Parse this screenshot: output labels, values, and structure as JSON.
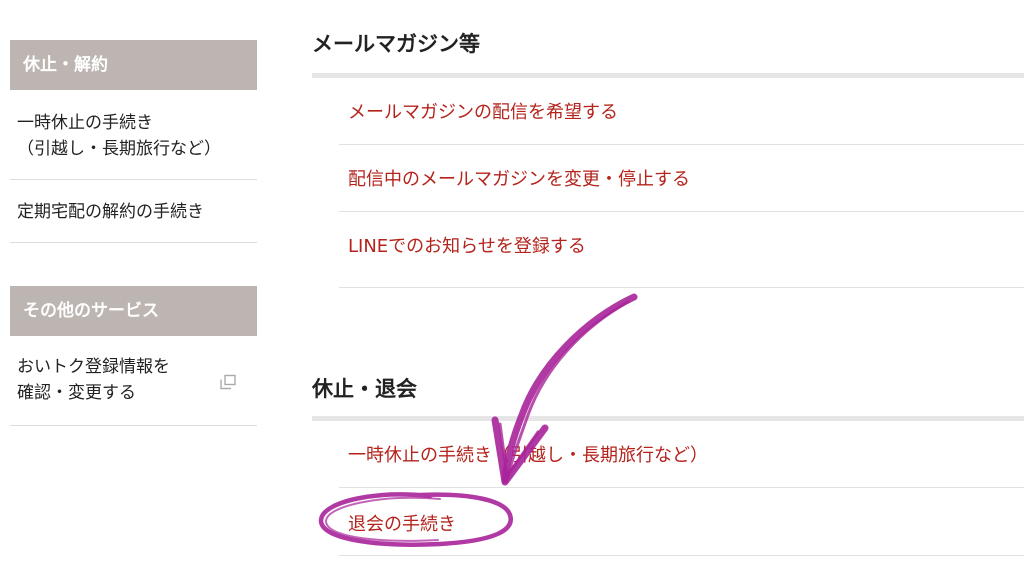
{
  "sidebar": {
    "sections": [
      {
        "title": "休止・解約",
        "items": [
          {
            "lines": [
              "一時休止の手続き",
              "（引越し・長期旅行など）"
            ]
          },
          {
            "lines": [
              "定期宅配の解約の手続き"
            ]
          }
        ]
      },
      {
        "title": "その他のサービス",
        "items": [
          {
            "lines": [
              "おいトク登録情報を",
              "確認・変更する"
            ],
            "icon": "external-window-icon"
          }
        ]
      }
    ]
  },
  "main": {
    "sections": [
      {
        "title": "メールマガジン等",
        "links": [
          "メールマガジンの配信を希望する",
          "配信中のメールマガジンを変更・停止する",
          "LINEでのお知らせを登録する"
        ]
      },
      {
        "title": "休止・退会",
        "links": [
          "一時休止の手続き（引越し・長期旅行など）",
          "退会の手続き"
        ]
      }
    ]
  },
  "annotation": {
    "color": "#a8249a",
    "shapes": [
      "hand-drawn-arrow",
      "hand-drawn-circle"
    ]
  },
  "colors": {
    "link": "#b4231c",
    "sidebar_header_bg": "#bdb5b1",
    "rule": "#e6e6e6"
  }
}
